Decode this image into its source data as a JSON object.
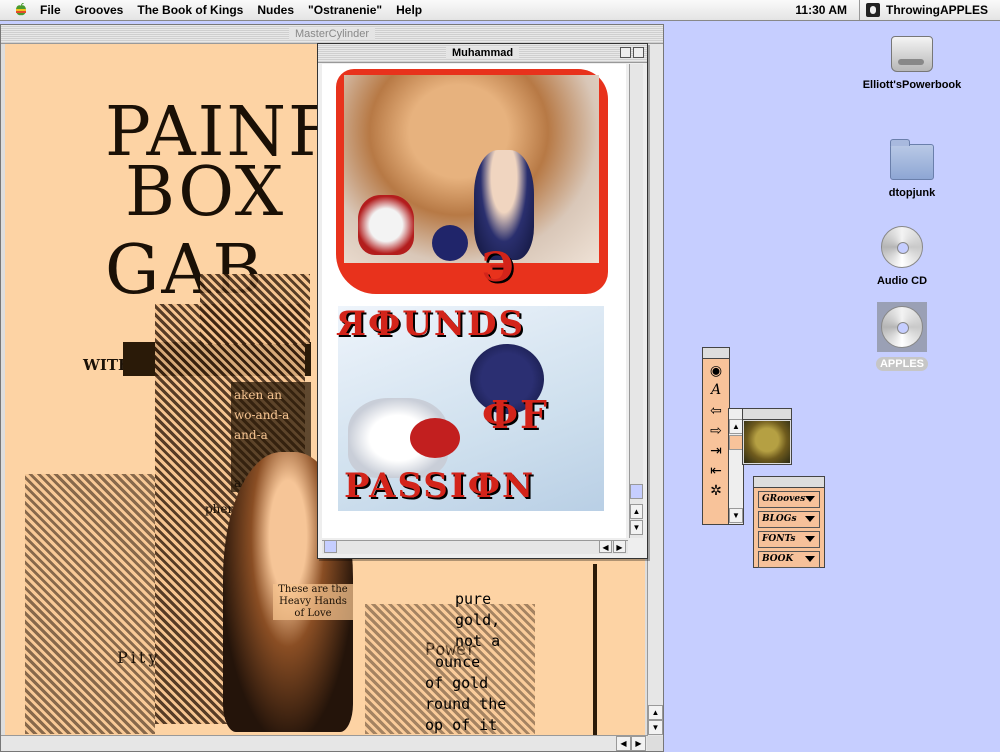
{
  "menubar": {
    "items": [
      "File",
      "Grooves",
      "The Book of Kings",
      "Nudes",
      "\"Ostranenie\"",
      "Help"
    ],
    "clock": "11:30 AM",
    "active_app": "ThrowingAPPLES"
  },
  "main_window": {
    "title": "MasterCylinder",
    "headline_lines": [
      "PAINF",
      "BOX",
      "GAB"
    ],
    "subhead": "WITH",
    "fragments": [
      "aken an",
      "wo-and-a",
      "and-a",
      "and-a",
      "pherbant."
    ],
    "caption": "These are the Heavy Hands of Love",
    "left_word": "Pity",
    "right_word": "Power",
    "poem": [
      "pure",
      "gold,",
      "not a",
      "ounce",
      "of gold",
      "round the",
      "op of it"
    ]
  },
  "muhammad_window": {
    "title": "Muhammad",
    "line1": "Э",
    "line2": "ЯФUNDS",
    "line3": "ФF",
    "line4": "PASSIФN"
  },
  "desktop": {
    "icons": [
      {
        "label": "Elliott'sPowerbook",
        "icon": "hard-drive-icon"
      },
      {
        "label": "dtopjunk",
        "icon": "folder-icon"
      },
      {
        "label": "Audio CD",
        "icon": "cd-icon"
      },
      {
        "label": "APPLES",
        "icon": "cd-icon"
      }
    ]
  },
  "palette": {
    "dropdowns": [
      "GRooves",
      "BLOGs",
      "FONTs",
      "BOOK"
    ]
  }
}
